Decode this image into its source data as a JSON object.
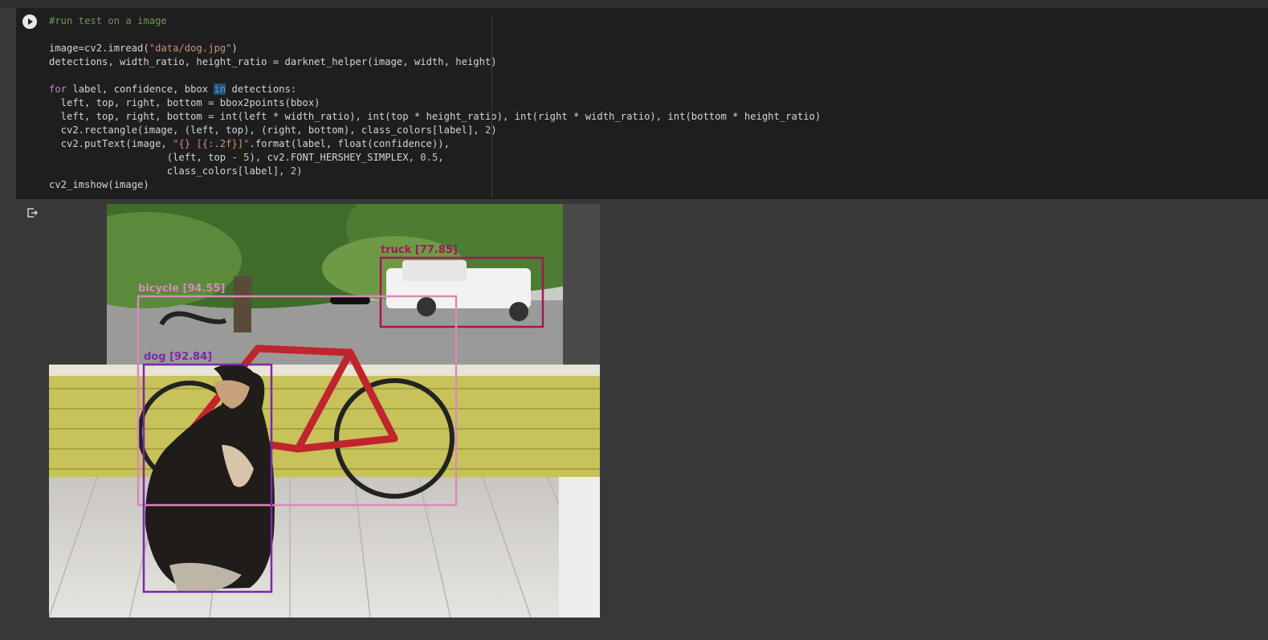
{
  "cell": {
    "run_button_label": "Run cell",
    "code_lines": [
      "#run test on a image",
      "",
      "image=cv2.imread(\"data/dog.jpg\")",
      "detections, width_ratio, height_ratio = darknet_helper(image, width, height)",
      "",
      "for label, confidence, bbox in detections:",
      "  left, top, right, bottom = bbox2points(bbox)",
      "  left, top, right, bottom = int(left * width_ratio), int(top * height_ratio), int(right * width_ratio), int(bottom * height_ratio)",
      "  cv2.rectangle(image, (left, top), (right, bottom), class_colors[label], 2)",
      "  cv2.putText(image, \"{} [{:.2f}]\".format(label, float(confidence)),",
      "                    (left, top - 5), cv2.FONT_HERSHEY_SIMPLEX, 0.5,",
      "                    class_colors[label], 2)",
      "cv2_imshow(image)"
    ]
  },
  "output": {
    "icon": "output-redirect-icon",
    "detections": [
      {
        "label": "truck [77.85]",
        "color": "#a8155a"
      },
      {
        "label": "bicycle [94.55]",
        "color": "#d98ab8"
      },
      {
        "label": "dog [92.84]",
        "color": "#7a2aa8"
      }
    ]
  },
  "colors": {
    "page_bg": "#383838",
    "cell_bg": "#1e1e1e",
    "comment": "#6a9955",
    "string": "#ce9178",
    "keyword": "#c586c0"
  }
}
